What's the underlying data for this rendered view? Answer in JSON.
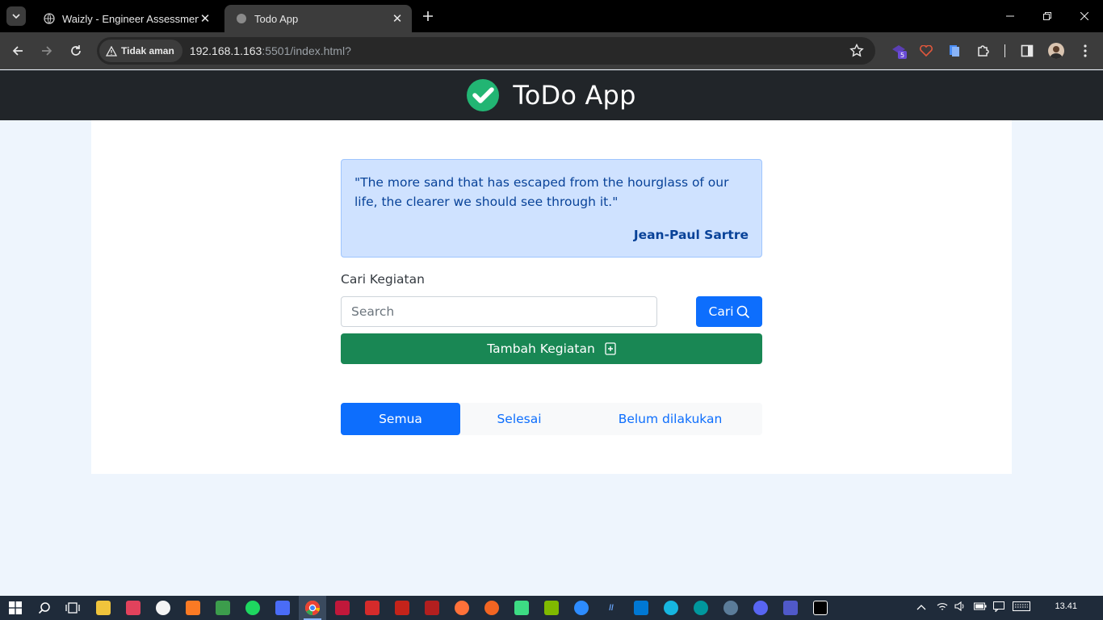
{
  "browser": {
    "tabs": [
      {
        "title": "Waizly - Engineer Assessment",
        "active": false
      },
      {
        "title": "Todo App",
        "active": true
      }
    ],
    "security_label": "Tidak aman",
    "url_host": "192.168.1.163",
    "url_rest": ":5501/index.html?",
    "extension_badge": "5"
  },
  "app": {
    "title": "ToDo App",
    "quote": {
      "text": "\"The more sand that has escaped from the hourglass of our life, the clearer we should see through it.\"",
      "author": "Jean-Paul Sartre"
    },
    "search": {
      "label": "Cari Kegiatan",
      "placeholder": "Search",
      "button_label": "Cari"
    },
    "add_button_label": "Tambah Kegiatan",
    "filters": [
      {
        "label": "Semua",
        "active": true
      },
      {
        "label": "Selesai",
        "active": false
      },
      {
        "label": "Belum dilakukan",
        "active": false
      }
    ]
  },
  "taskbar": {
    "clock": "13.41"
  },
  "colors": {
    "header_bg": "#212529",
    "primary": "#0d6efd",
    "success": "#198754",
    "quote_bg": "#cfe2ff",
    "page_bg": "#eef5fd"
  }
}
